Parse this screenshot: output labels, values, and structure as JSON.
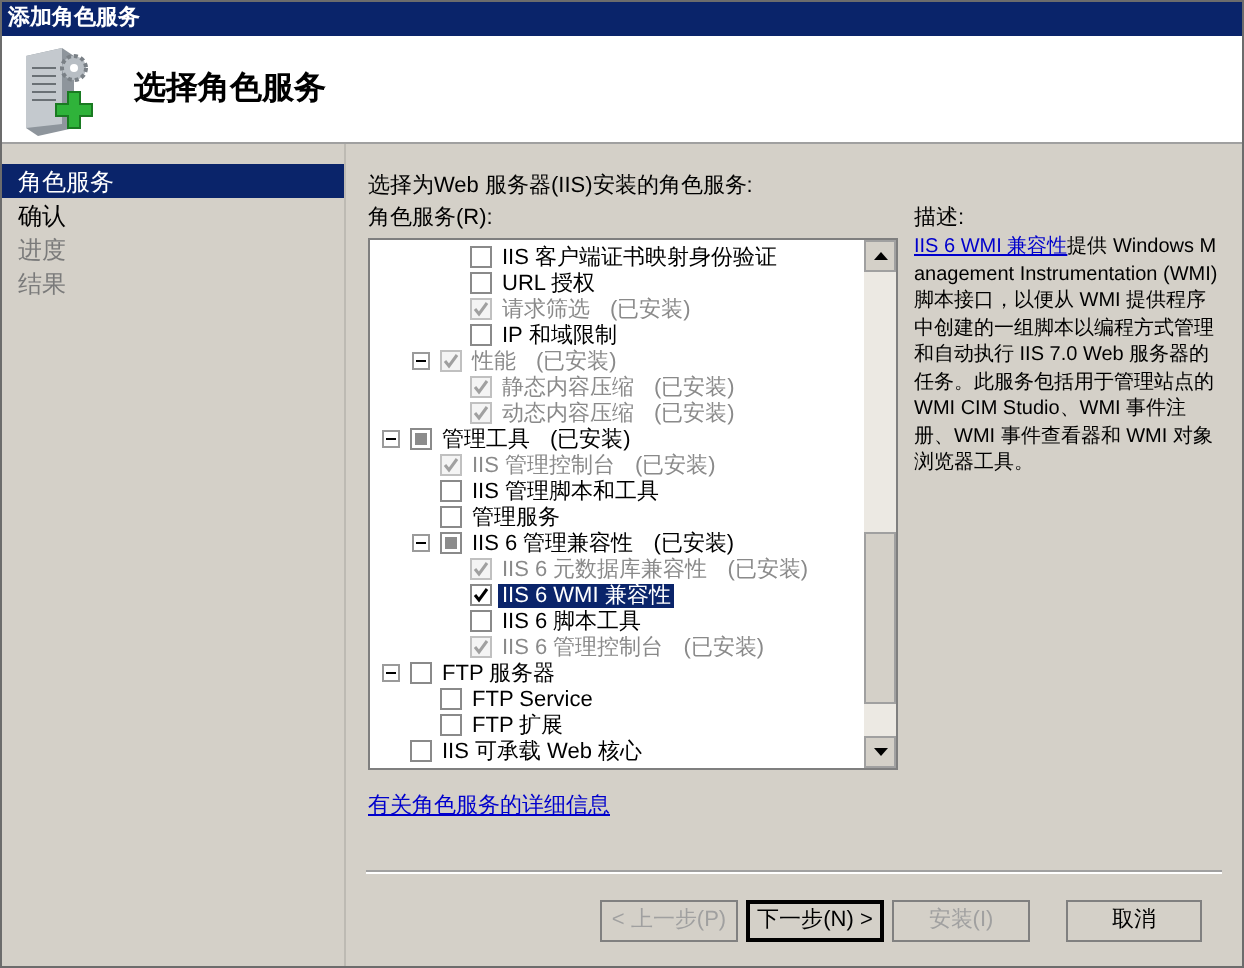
{
  "window": {
    "title": "添加角色服务"
  },
  "header": {
    "title": "选择角色服务"
  },
  "sidebar": {
    "items": [
      {
        "label": "角色服务",
        "selected": true,
        "disabled": false
      },
      {
        "label": "确认",
        "selected": false,
        "disabled": false
      },
      {
        "label": "进度",
        "selected": false,
        "disabled": true
      },
      {
        "label": "结果",
        "selected": false,
        "disabled": true
      }
    ]
  },
  "intro": "选择为Web 服务器(IIS)安装的角色服务:",
  "tree_label": "角色服务(R):",
  "tree": [
    {
      "children": [
        {
          "children": [
            {
              "label": "IIS 客户端证书映射身份验证",
              "checked": false,
              "indeterminate": false,
              "disabled": false,
              "selected": false
            },
            {
              "label": "URL 授权",
              "checked": false,
              "indeterminate": false,
              "disabled": false,
              "selected": false
            },
            {
              "label": "请求筛选",
              "status": "(已安装)",
              "checked": true,
              "indeterminate": false,
              "disabled": true,
              "selected": false
            },
            {
              "label": "IP 和域限制",
              "checked": false,
              "indeterminate": false,
              "disabled": false,
              "selected": false
            }
          ]
        },
        {
          "label": "性能",
          "status": "(已安装)",
          "checked": true,
          "indeterminate": false,
          "disabled": true,
          "selected": false,
          "expanded": true,
          "children": [
            {
              "label": "静态内容压缩",
              "status": "(已安装)",
              "checked": true,
              "indeterminate": false,
              "disabled": true,
              "selected": false
            },
            {
              "label": "动态内容压缩",
              "status": "(已安装)",
              "checked": true,
              "indeterminate": false,
              "disabled": true,
              "selected": false
            }
          ]
        }
      ]
    },
    {
      "label": "管理工具",
      "status": "(已安装)",
      "checked": false,
      "indeterminate": true,
      "disabled": false,
      "selected": false,
      "expanded": true,
      "children": [
        {
          "label": "IIS 管理控制台",
          "status": "(已安装)",
          "checked": true,
          "indeterminate": false,
          "disabled": true,
          "selected": false
        },
        {
          "label": "IIS 管理脚本和工具",
          "checked": false,
          "indeterminate": false,
          "disabled": false,
          "selected": false
        },
        {
          "label": "管理服务",
          "checked": false,
          "indeterminate": false,
          "disabled": false,
          "selected": false
        },
        {
          "label": "IIS 6 管理兼容性",
          "status": "(已安装)",
          "checked": false,
          "indeterminate": true,
          "disabled": false,
          "selected": false,
          "expanded": true,
          "children": [
            {
              "label": "IIS 6 元数据库兼容性",
              "status": "(已安装)",
              "checked": true,
              "indeterminate": false,
              "disabled": true,
              "selected": false
            },
            {
              "label": "IIS 6 WMI 兼容性",
              "checked": true,
              "indeterminate": false,
              "disabled": false,
              "selected": true
            },
            {
              "label": "IIS 6 脚本工具",
              "checked": false,
              "indeterminate": false,
              "disabled": false,
              "selected": false
            },
            {
              "label": "IIS 6 管理控制台",
              "status": "(已安装)",
              "checked": true,
              "indeterminate": false,
              "disabled": true,
              "selected": false
            }
          ]
        }
      ]
    },
    {
      "label": "FTP 服务器",
      "checked": false,
      "indeterminate": false,
      "disabled": false,
      "selected": false,
      "expanded": true,
      "children": [
        {
          "label": "FTP Service",
          "checked": false,
          "indeterminate": false,
          "disabled": false,
          "selected": false
        },
        {
          "label": "FTP 扩展",
          "checked": false,
          "indeterminate": false,
          "disabled": false,
          "selected": false
        }
      ]
    },
    {
      "label": "IIS 可承载 Web 核心",
      "checked": false,
      "indeterminate": false,
      "disabled": false,
      "selected": false
    }
  ],
  "description": {
    "heading": "描述:",
    "link": "IIS 6 WMI 兼容性",
    "text": "提供 Windows Management Instrumentation (WMI)脚本接口，以便从 WMI 提供程序中创建的一组脚本以编程方式管理和自动执行 IIS 7.0 Web 服务器的任务。此服务包括用于管理站点的 WMI CIM Studio、WMI 事件注册、WMI 事件查看器和 WMI 对象浏览器工具。"
  },
  "more_info_link": "有关角色服务的详细信息",
  "buttons": [
    {
      "label": "< 上一步(P)",
      "disabled": true,
      "default": false
    },
    {
      "label": "下一步(N) >",
      "disabled": false,
      "default": true
    },
    {
      "label": "安装(I)",
      "disabled": true,
      "default": false
    },
    {
      "label": "取消",
      "disabled": false,
      "default": false
    }
  ]
}
